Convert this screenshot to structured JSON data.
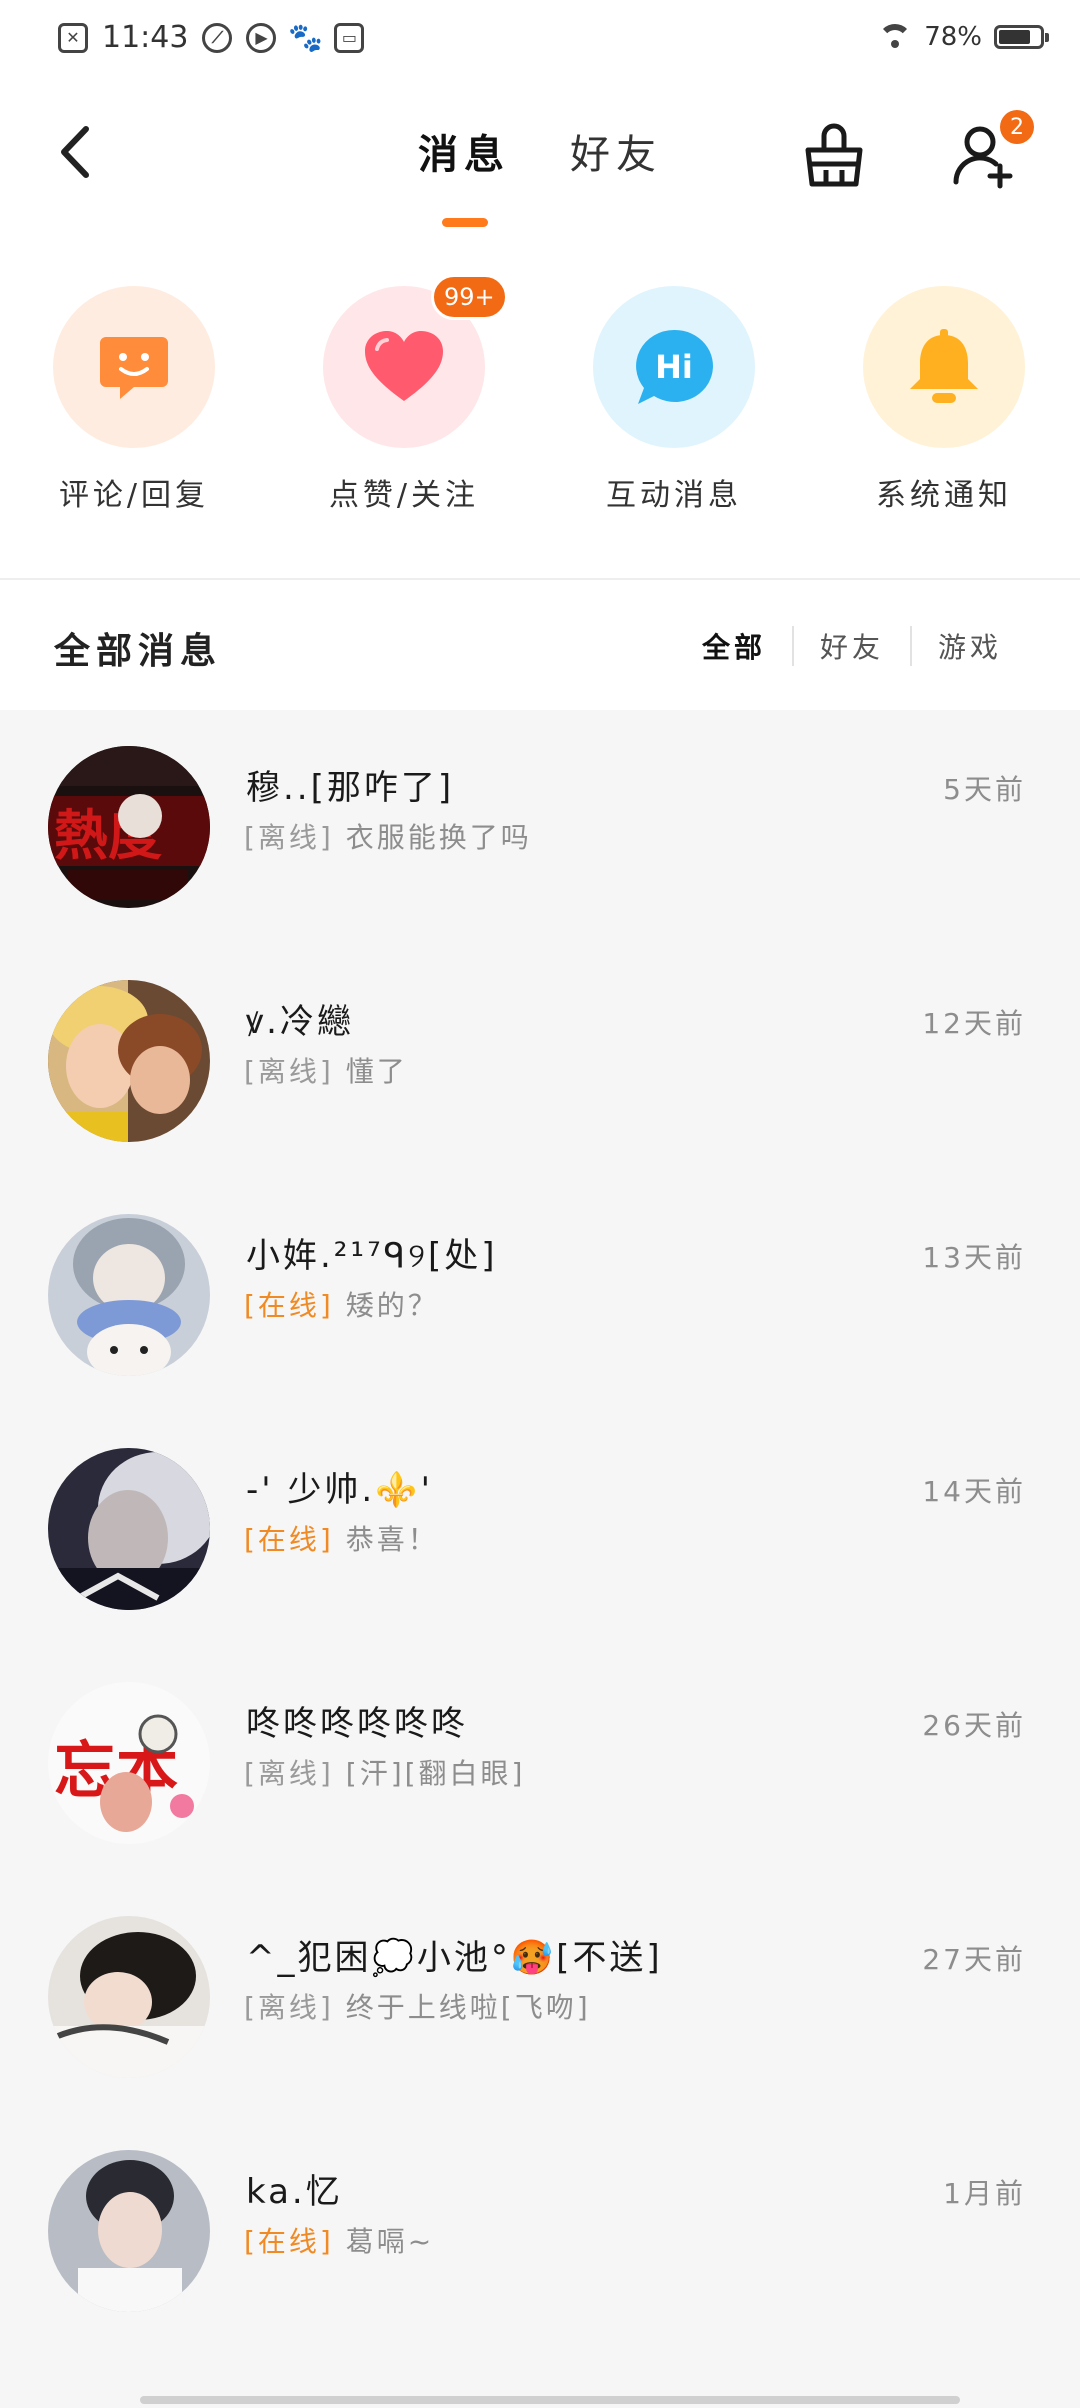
{
  "status_bar": {
    "time": "11:43",
    "battery": "78%",
    "battery_level": 0.78
  },
  "header": {
    "tabs": [
      {
        "label": "消息",
        "active": true
      },
      {
        "label": "好友",
        "active": false
      }
    ],
    "friend_request_count": "2"
  },
  "categories": [
    {
      "label": "评论/回复",
      "icon": "smile-chat-icon",
      "color": "#ff8c3a",
      "bg": "#ffece0"
    },
    {
      "label": "点赞/关注",
      "icon": "heart-icon",
      "color": "#ff5a6e",
      "bg": "#ffe6e8",
      "badge": "99+"
    },
    {
      "label": "互动消息",
      "icon": "hi-bubble-icon",
      "color": "#2bb0f0",
      "bg": "#e0f4fd"
    },
    {
      "label": "系统通知",
      "icon": "bell-icon",
      "color": "#ffb020",
      "bg": "#fff2d6"
    }
  ],
  "section": {
    "title": "全部消息",
    "filters": [
      "全部",
      "好友",
      "游戏"
    ],
    "active_filter": "全部"
  },
  "messages": [
    {
      "name": "穆..[那咋了]",
      "status": "[离线]",
      "online": false,
      "preview": "衣服能换了吗",
      "time": "5天前"
    },
    {
      "name": "ꝟ.冷纞",
      "status": "[离线]",
      "online": false,
      "preview": "懂了",
      "time": "12天前"
    },
    {
      "name": "小姩.²¹⁷ᑫ୨[处]",
      "status": "[在线]",
      "online": true,
      "preview": "矮的？",
      "time": "13天前"
    },
    {
      "name": "-' 少帅.⚜️'",
      "status": "[在线]",
      "online": true,
      "preview": "恭喜！",
      "time": "14天前"
    },
    {
      "name": "咚咚咚咚咚咚",
      "status": "[离线]",
      "online": false,
      "preview": "[汗][翻白眼]",
      "time": "26天前"
    },
    {
      "name": "^_犯困💭小池°🥵[不送]",
      "status": "[离线]",
      "online": false,
      "preview": "终于上线啦[飞吻]",
      "time": "27天前"
    },
    {
      "name": "ka.忆",
      "status": "[在线]",
      "online": true,
      "preview": "葛嗝~",
      "time": "1月前"
    }
  ]
}
